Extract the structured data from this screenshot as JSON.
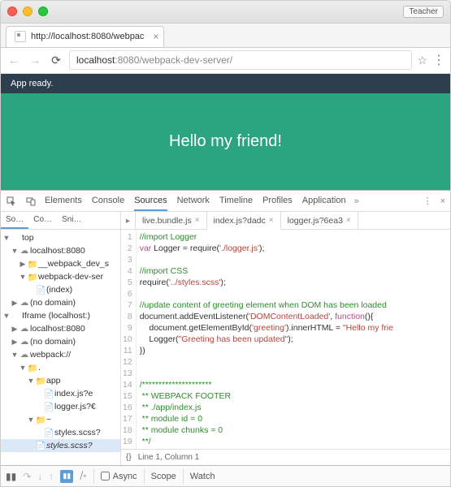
{
  "teacher_label": "Teacher",
  "tab": {
    "title": "http://localhost:8080/webpac"
  },
  "url": {
    "host": "localhost",
    "path": ":8080/webpack-dev-server/"
  },
  "app_status": "App ready.",
  "hero_text": "Hello my friend!",
  "devtools": {
    "tabs": [
      "Elements",
      "Console",
      "Sources",
      "Network",
      "Timeline",
      "Profiles",
      "Application"
    ],
    "sidebar_tabs": [
      "So…",
      "Co…",
      "Sni…"
    ],
    "tree": [
      {
        "depth": 0,
        "tw": "▼",
        "ic": "",
        "label": "top",
        "cls": ""
      },
      {
        "depth": 1,
        "tw": "▼",
        "ic": "☁",
        "label": "localhost:8080",
        "cls": "cloud"
      },
      {
        "depth": 2,
        "tw": "▶",
        "ic": "📁",
        "label": "__webpack_dev_s",
        "cls": "folder"
      },
      {
        "depth": 2,
        "tw": "▼",
        "ic": "📁",
        "label": "webpack-dev-ser",
        "cls": "folder"
      },
      {
        "depth": 3,
        "tw": "",
        "ic": "📄",
        "label": "(index)",
        "cls": "file"
      },
      {
        "depth": 1,
        "tw": "▶",
        "ic": "☁",
        "label": "(no domain)",
        "cls": "cloud"
      },
      {
        "depth": 0,
        "tw": "▼",
        "ic": "",
        "label": "Iframe (localhost:)",
        "cls": ""
      },
      {
        "depth": 1,
        "tw": "▶",
        "ic": "☁",
        "label": "localhost:8080",
        "cls": "cloud"
      },
      {
        "depth": 1,
        "tw": "▶",
        "ic": "☁",
        "label": "(no domain)",
        "cls": "cloud"
      },
      {
        "depth": 1,
        "tw": "▼",
        "ic": "☁",
        "label": "webpack://",
        "cls": "cloud"
      },
      {
        "depth": 2,
        "tw": "▼",
        "ic": "📁",
        "label": ".",
        "cls": "folderY"
      },
      {
        "depth": 3,
        "tw": "▼",
        "ic": "📁",
        "label": "app",
        "cls": "folderY"
      },
      {
        "depth": 4,
        "tw": "",
        "ic": "📄",
        "label": "index.js?e",
        "cls": "file"
      },
      {
        "depth": 4,
        "tw": "",
        "ic": "📄",
        "label": "logger.js?€",
        "cls": "file"
      },
      {
        "depth": 3,
        "tw": "▼",
        "ic": "📁",
        "label": "~",
        "cls": "folderY"
      },
      {
        "depth": 4,
        "tw": "",
        "ic": "📄",
        "label": "styles.scss?",
        "cls": "file"
      },
      {
        "depth": 3,
        "tw": "",
        "ic": "📄",
        "label": "styles.scss?",
        "cls": "file",
        "sel": true
      }
    ],
    "file_tabs": [
      {
        "name": "live.bundle.js",
        "active": false
      },
      {
        "name": "index.js?dadc",
        "active": true
      },
      {
        "name": "logger.js?6ea3",
        "active": false
      }
    ],
    "code_lines": [
      {
        "n": 1,
        "html": "<span class='c-com'>//import Logger</span>"
      },
      {
        "n": 2,
        "html": "<span class='c-kw'>var</span> Logger = require(<span class='c-str'>'./logger.js'</span>);"
      },
      {
        "n": 3,
        "html": ""
      },
      {
        "n": 4,
        "html": "<span class='c-com'>//import CSS</span>"
      },
      {
        "n": 5,
        "html": "require(<span class='c-str'>'../styles.scss'</span>);"
      },
      {
        "n": 6,
        "html": ""
      },
      {
        "n": 7,
        "html": "<span class='c-com'>//update content of greeting element when DOM has been loaded</span>"
      },
      {
        "n": 8,
        "html": "document.addEventListener(<span class='c-str'>'DOMContentLoaded'</span>, <span class='c-kw'>function</span>(){"
      },
      {
        "n": 9,
        "html": "    document.getElementById(<span class='c-str'>'greeting'</span>).innerHTML = <span class='c-str'>\"Hello my frie</span>"
      },
      {
        "n": 10,
        "html": "    Logger(<span class='c-str'>\"Greeting has been updated\"</span>);"
      },
      {
        "n": 11,
        "html": "})"
      },
      {
        "n": 12,
        "html": ""
      },
      {
        "n": 13,
        "html": ""
      },
      {
        "n": 14,
        "html": "<span class='c-com'>/*********************</span>"
      },
      {
        "n": 15,
        "html": "<span class='c-com'> ** WEBPACK FOOTER</span>"
      },
      {
        "n": 16,
        "html": "<span class='c-com'> ** ./app/index.js</span>"
      },
      {
        "n": 17,
        "html": "<span class='c-com'> ** module id = 0</span>"
      },
      {
        "n": 18,
        "html": "<span class='c-com'> ** module chunks = 0</span>"
      },
      {
        "n": 19,
        "html": "<span class='c-com'> **/</span>"
      }
    ],
    "status": "Line 1, Column 1",
    "footer": {
      "async": "Async",
      "scope": "Scope",
      "watch": "Watch"
    }
  }
}
